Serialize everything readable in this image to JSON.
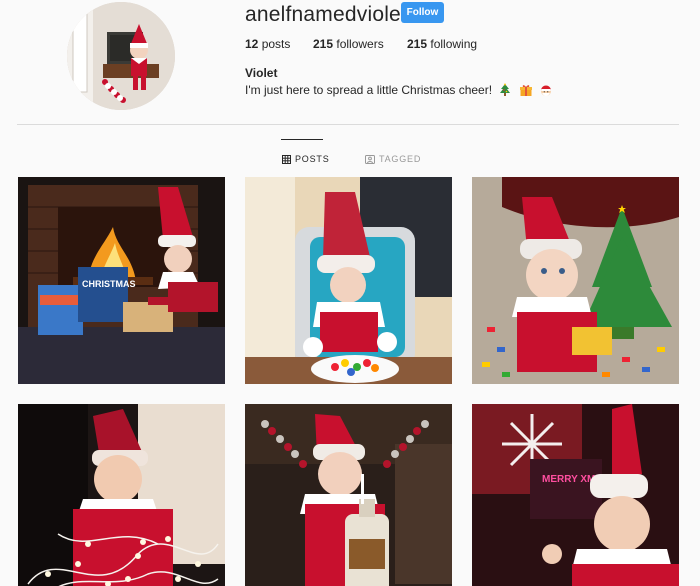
{
  "profile": {
    "username": "anelfnamedviolet",
    "follow_label": "Follow",
    "posts_count": "12",
    "posts_label": "posts",
    "followers_count": "215",
    "followers_label": "followers",
    "following_count": "215",
    "following_label": "following",
    "full_name": "Violet",
    "bio": "I'm just here to spread a little Christmas cheer!"
  },
  "tabs": [
    {
      "label": "POSTS",
      "icon": "grid-icon",
      "active": true
    },
    {
      "label": "TAGGED",
      "icon": "tag-icon",
      "active": false
    }
  ],
  "posts": [
    {
      "scene": "fireplace-elf-with-books",
      "sign_text": "CHRISTMAS"
    },
    {
      "scene": "elf-in-high-chair-with-cereal"
    },
    {
      "scene": "elf-with-lego-tree"
    },
    {
      "scene": "elf-tangled-in-lights"
    },
    {
      "scene": "elf-drinking-maple-syrup"
    },
    {
      "scene": "elf-with-merry-xmas-sign",
      "sign_text": "MERRY XMAS"
    }
  ],
  "colors": {
    "follow_blue": "#3897f0",
    "elf_red": "#c8102e",
    "text": "#262626",
    "muted": "#999999"
  }
}
